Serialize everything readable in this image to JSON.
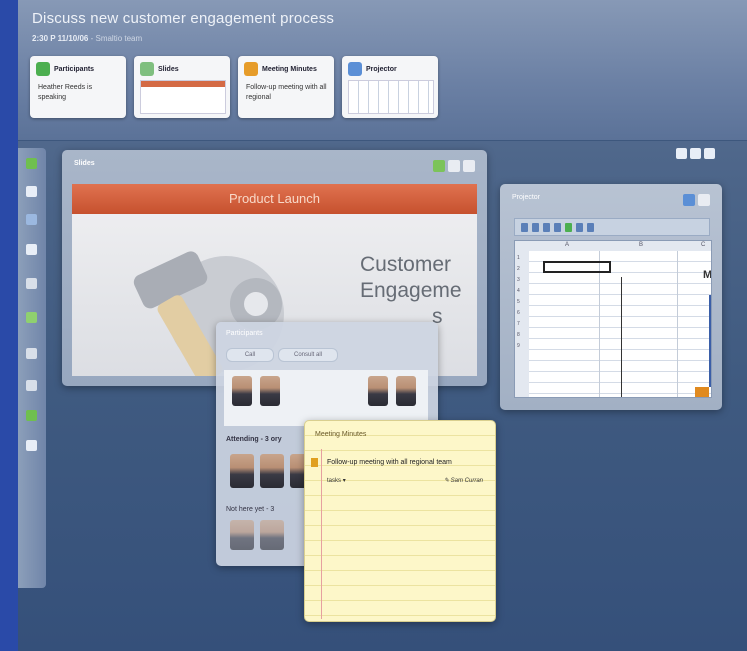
{
  "meeting": {
    "title": "Discuss new customer engagement process",
    "time": "2:30 P 11/10/06",
    "subtitle_extra": "- Smaltio team"
  },
  "cards": [
    {
      "title": "Participants",
      "body": "Heather Reeds is speaking",
      "icon_color": "#4caf50"
    },
    {
      "title": "Slides",
      "body": "",
      "icon_color": "#7fbf7f"
    },
    {
      "title": "Meeting Minutes",
      "body": "Follow-up meeting with all regional",
      "icon_color": "#e69c2a"
    },
    {
      "title": "Projector",
      "body": "",
      "icon_color": "#5b8fd6"
    }
  ],
  "slides_panel": {
    "title": "Slides",
    "slide_header": "Product Launch",
    "slide_lines": [
      "Customer",
      "Engageme",
      "s"
    ]
  },
  "projector_panel": {
    "title": "Projector",
    "row_numbers": [
      "1",
      "2",
      "3",
      "4",
      "5",
      "6",
      "7",
      "8",
      "9"
    ],
    "col_headers": [
      "A",
      "B",
      "C"
    ],
    "cell_text": "M"
  },
  "participants_panel": {
    "title": "Participants",
    "buttons": [
      "Call",
      "Consult all"
    ],
    "section_attending": "Attending - 3 ory",
    "section_not_here": "Not here yet - 3"
  },
  "minutes_panel": {
    "title": "Meeting Minutes",
    "item": "Follow-up meeting with all regional team",
    "task_label": "tasks",
    "owner": "Sam Curran"
  },
  "colors": {
    "background": "#2a4aa8",
    "accent_orange": "#c6512e"
  }
}
